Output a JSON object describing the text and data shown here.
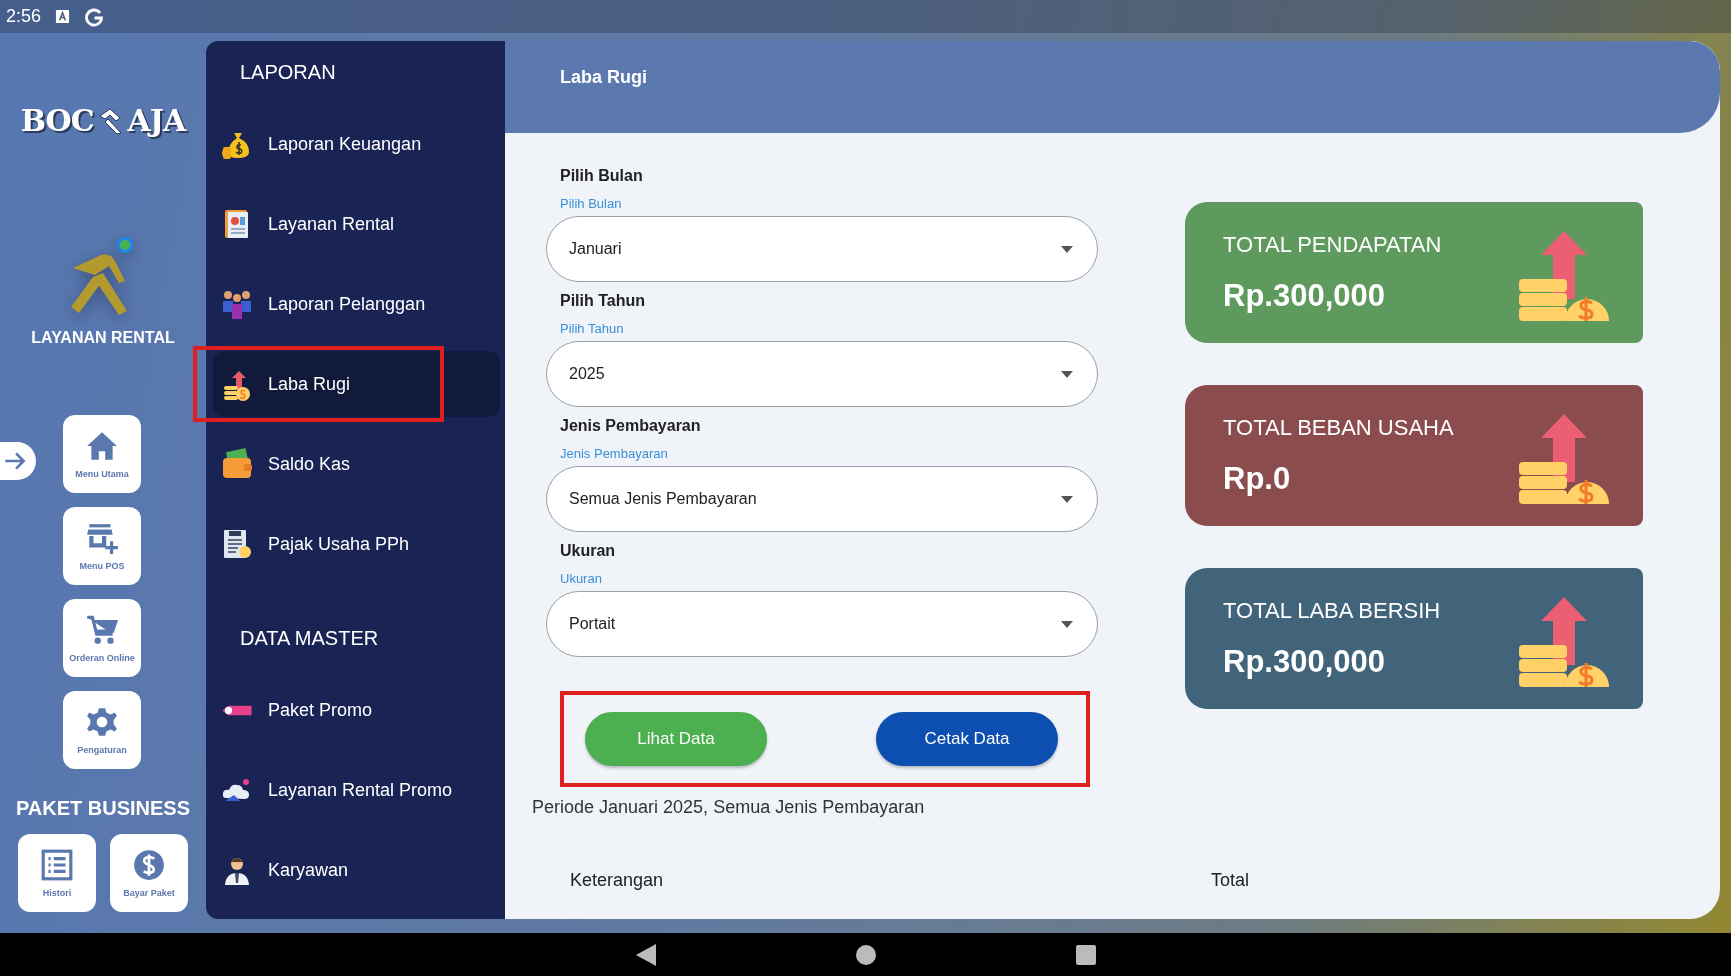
{
  "status_bar": {
    "time": "2:56"
  },
  "rail": {
    "logo_left": "BOC",
    "logo_right": "AJA",
    "app_label": "LAYANAN RENTAL",
    "nav_items": [
      {
        "label": "Menu Utama",
        "kind": "home"
      },
      {
        "label": "Menu POS",
        "kind": "store"
      },
      {
        "label": "Orderan Online",
        "kind": "cart"
      },
      {
        "label": "Pengaturan",
        "kind": "gear"
      }
    ],
    "section_title": "PAKET BUSINESS",
    "package_items": [
      {
        "label": "Histori",
        "kind": "list"
      },
      {
        "label": "Bayar Paket",
        "kind": "dollar"
      }
    ]
  },
  "sidebar": {
    "sections": [
      {
        "title": "LAPORAN",
        "items": [
          {
            "label": "Laporan Keuangan",
            "kind": "moneybag",
            "selected": false,
            "highlighted": false
          },
          {
            "label": "Layanan Rental",
            "kind": "report",
            "selected": false,
            "highlighted": false
          },
          {
            "label": "Laporan Pelanggan",
            "kind": "people",
            "selected": false,
            "highlighted": false
          },
          {
            "label": "Laba Rugi",
            "kind": "coins",
            "selected": true,
            "highlighted": true
          },
          {
            "label": "Saldo Kas",
            "kind": "wallet",
            "selected": false,
            "highlighted": false
          },
          {
            "label": "Pajak Usaha PPh",
            "kind": "tax",
            "selected": false,
            "highlighted": false
          }
        ]
      },
      {
        "title": "DATA MASTER",
        "items": [
          {
            "label": "Paket Promo",
            "kind": "tag",
            "selected": false,
            "highlighted": false
          },
          {
            "label": "Layanan Rental Promo",
            "kind": "cloud",
            "selected": false,
            "highlighted": false
          },
          {
            "label": "Karyawan",
            "kind": "person",
            "selected": false,
            "highlighted": false
          }
        ]
      }
    ]
  },
  "header": {
    "title": "Laba Rugi"
  },
  "form": {
    "fields": [
      {
        "label": "Pilih Bulan",
        "floating_label": "Pilih Bulan",
        "value": "Januari"
      },
      {
        "label": "Pilih Tahun",
        "floating_label": "Pilih Tahun",
        "value": "2025"
      },
      {
        "label": "Jenis Pembayaran",
        "floating_label": "Jenis Pembayaran",
        "value": "Semua Jenis Pembayaran"
      },
      {
        "label": "Ukuran",
        "floating_label": "Ukuran",
        "value": "Portait"
      }
    ],
    "buttons_highlighted": true,
    "buttons": [
      {
        "label": "Lihat Data",
        "kind": "view"
      },
      {
        "label": "Cetak Data",
        "kind": "print"
      }
    ]
  },
  "period": "Periode Januari 2025, Semua Jenis Pembayaran",
  "summary_cards": [
    {
      "title": "TOTAL PENDAPATAN",
      "amount": "Rp.300,000",
      "color": "#5e9a5e"
    },
    {
      "title": "TOTAL BEBAN USAHA",
      "amount": "Rp.0",
      "color": "#8b4c4e"
    },
    {
      "title": "TOTAL LABA BERSIH",
      "amount": "Rp.300,000",
      "color": "#41647b"
    }
  ],
  "table": {
    "columns": [
      "Keterangan",
      "Total"
    ]
  }
}
